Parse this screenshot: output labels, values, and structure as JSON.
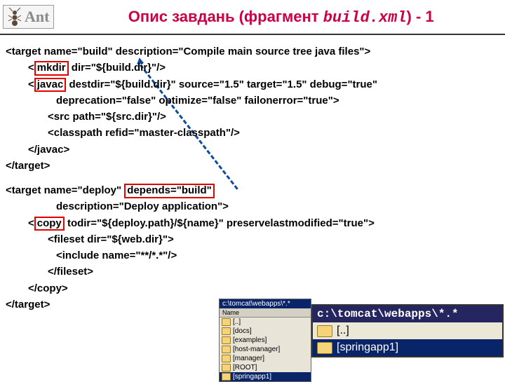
{
  "header": {
    "logo_text": "Ant",
    "title_prefix": "Опис завдань (фрагмент ",
    "title_filename": "build.xml",
    "title_suffix": ") - 1"
  },
  "code": {
    "l1": "<target name=\"build\" description=\"Compile main source tree java files\">",
    "l2_tag": "mkdir",
    "l2_rest": " dir=\"${build.dir}\"/>",
    "l3_tag": "javac",
    "l3_rest": " destdir=\"${build.dir}\" source=\"1.5\" target=\"1.5\" debug=\"true\"",
    "l4": "deprecation=\"false\" optimize=\"false\" failonerror=\"true\">",
    "l5": "<src path=\"${src.dir}\"/>",
    "l6": "<classpath refid=\"master-classpath\"/>",
    "l7": "</javac>",
    "l8": "</target>",
    "l9_pre": "<target name=\"deploy\" ",
    "l9_box": "depends=\"build\"",
    "l10": "description=\"Deploy application\">",
    "l11_tag": "copy",
    "l11_rest": " todir=\"${deploy.path}/${name}\" preservelastmodified=\"true\">",
    "l12": "<fileset dir=\"${web.dir}\">",
    "l13": "<include name=\"**/*.*\"/>",
    "l14": "</fileset>",
    "l15": "</copy>",
    "l16": "</target>"
  },
  "file_panel": {
    "path": "c:\\tomcat\\webapps\\*.*",
    "col_header": "Name",
    "rows": [
      "[..]",
      "[docs]",
      "[examples]",
      "[host-manager]",
      "[manager]",
      "[ROOT]",
      "[springapp1]"
    ]
  },
  "large_panel": {
    "title": "c:\\tomcat\\webapps\\*.*",
    "row1": "[..]",
    "row2": "[springapp1]"
  }
}
